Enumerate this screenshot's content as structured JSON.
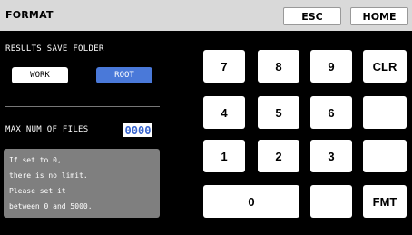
{
  "header": {
    "title": "FORMAT",
    "esc_label": "ESC",
    "home_label": "HOME"
  },
  "results_save_folder": {
    "label": "RESULTS SAVE FOLDER",
    "options": [
      "WORK",
      "ROOT"
    ],
    "selected": "ROOT"
  },
  "max_num_files": {
    "label": "MAX NUM OF FILES",
    "value": "0000"
  },
  "info": {
    "lines": [
      "If set to 0,",
      "there is no limit.",
      "Please set it",
      "between 0 and 5000."
    ]
  },
  "keypad": {
    "k7": "7",
    "k8": "8",
    "k9": "9",
    "clr": "CLR",
    "k4": "4",
    "k5": "5",
    "k6": "6",
    "k1": "1",
    "k2": "2",
    "k3": "3",
    "k0": "0",
    "fmt": "FMT"
  },
  "colors": {
    "header_bg": "#d9d9d9",
    "background": "#000000",
    "selected_button": "#4a79d9",
    "value_text": "#3a66d0",
    "info_bg": "#7f7f7f"
  }
}
